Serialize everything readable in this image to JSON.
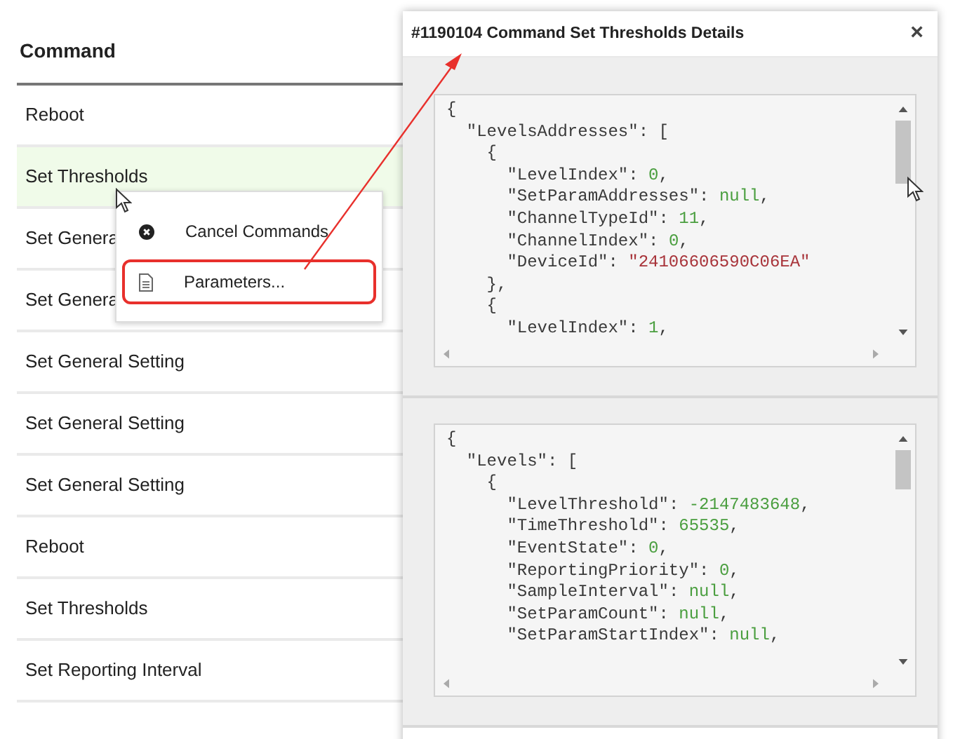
{
  "table": {
    "columns": [
      "Command"
    ],
    "rows": [
      {
        "command": "Reboot",
        "selected": false
      },
      {
        "command": "Set Thresholds",
        "selected": true
      },
      {
        "command": "Set Genera",
        "selected": false
      },
      {
        "command": "Set Genera",
        "selected": false
      },
      {
        "command": "Set General Setting",
        "selected": false
      },
      {
        "command": "Set General Setting",
        "selected": false
      },
      {
        "command": "Set General Setting",
        "selected": false
      },
      {
        "command": "Reboot",
        "selected": false
      },
      {
        "command": "Set Thresholds",
        "selected": false
      },
      {
        "command": "Set Reporting Interval",
        "selected": false
      }
    ]
  },
  "context_menu": {
    "items": [
      {
        "label": "Cancel Commands",
        "kind": "cancel",
        "highlighted": false
      },
      {
        "label": "Parameters...",
        "kind": "document",
        "highlighted": true
      }
    ]
  },
  "dialog": {
    "title": "#1190104 Command Set Thresholds Details",
    "close": "×",
    "panels": [
      {
        "lines": [
          [
            {
              "kind": "punct",
              "text": "{"
            }
          ],
          [
            {
              "kind": "key",
              "text": "  \"LevelsAddresses\""
            },
            {
              "kind": "punct",
              "text": ": ["
            }
          ],
          [
            {
              "kind": "punct",
              "text": "    {"
            }
          ],
          [
            {
              "kind": "key",
              "text": "      \"LevelIndex\""
            },
            {
              "kind": "punct",
              "text": ": "
            },
            {
              "kind": "number",
              "text": "0"
            },
            {
              "kind": "punct",
              "text": ","
            }
          ],
          [
            {
              "kind": "key",
              "text": "      \"SetParamAddresses\""
            },
            {
              "kind": "punct",
              "text": ": "
            },
            {
              "kind": "number",
              "text": "null"
            },
            {
              "kind": "punct",
              "text": ","
            }
          ],
          [
            {
              "kind": "key",
              "text": "      \"ChannelTypeId\""
            },
            {
              "kind": "punct",
              "text": ": "
            },
            {
              "kind": "number",
              "text": "11"
            },
            {
              "kind": "punct",
              "text": ","
            }
          ],
          [
            {
              "kind": "key",
              "text": "      \"ChannelIndex\""
            },
            {
              "kind": "punct",
              "text": ": "
            },
            {
              "kind": "number",
              "text": "0"
            },
            {
              "kind": "punct",
              "text": ","
            }
          ],
          [
            {
              "kind": "key",
              "text": "      \"DeviceId\""
            },
            {
              "kind": "punct",
              "text": ": "
            },
            {
              "kind": "string",
              "text": "\"24106606590C06EA\""
            }
          ],
          [
            {
              "kind": "punct",
              "text": "    },"
            }
          ],
          [
            {
              "kind": "punct",
              "text": "    {"
            }
          ],
          [
            {
              "kind": "key",
              "text": "      \"LevelIndex\""
            },
            {
              "kind": "punct",
              "text": ": "
            },
            {
              "kind": "number",
              "text": "1"
            },
            {
              "kind": "punct",
              "text": ","
            }
          ]
        ]
      },
      {
        "lines": [
          [
            {
              "kind": "punct",
              "text": "{"
            }
          ],
          [
            {
              "kind": "key",
              "text": "  \"Levels\""
            },
            {
              "kind": "punct",
              "text": ": ["
            }
          ],
          [
            {
              "kind": "punct",
              "text": "    {"
            }
          ],
          [
            {
              "kind": "key",
              "text": "      \"LevelThreshold\""
            },
            {
              "kind": "punct",
              "text": ": "
            },
            {
              "kind": "number",
              "text": "-2147483648"
            },
            {
              "kind": "punct",
              "text": ","
            }
          ],
          [
            {
              "kind": "key",
              "text": "      \"TimeThreshold\""
            },
            {
              "kind": "punct",
              "text": ": "
            },
            {
              "kind": "number",
              "text": "65535"
            },
            {
              "kind": "punct",
              "text": ","
            }
          ],
          [
            {
              "kind": "key",
              "text": "      \"EventState\""
            },
            {
              "kind": "punct",
              "text": ": "
            },
            {
              "kind": "number",
              "text": "0"
            },
            {
              "kind": "punct",
              "text": ","
            }
          ],
          [
            {
              "kind": "key",
              "text": "      \"ReportingPriority\""
            },
            {
              "kind": "punct",
              "text": ": "
            },
            {
              "kind": "number",
              "text": "0"
            },
            {
              "kind": "punct",
              "text": ","
            }
          ],
          [
            {
              "kind": "key",
              "text": "      \"SampleInterval\""
            },
            {
              "kind": "punct",
              "text": ": "
            },
            {
              "kind": "number",
              "text": "null"
            },
            {
              "kind": "punct",
              "text": ","
            }
          ],
          [
            {
              "kind": "key",
              "text": "      \"SetParamCount\""
            },
            {
              "kind": "punct",
              "text": ": "
            },
            {
              "kind": "number",
              "text": "null"
            },
            {
              "kind": "punct",
              "text": ","
            }
          ],
          [
            {
              "kind": "key",
              "text": "      \"SetParamStartIndex\""
            },
            {
              "kind": "punct",
              "text": ": "
            },
            {
              "kind": "number",
              "text": "null"
            },
            {
              "kind": "punct",
              "text": ","
            }
          ]
        ]
      }
    ]
  }
}
